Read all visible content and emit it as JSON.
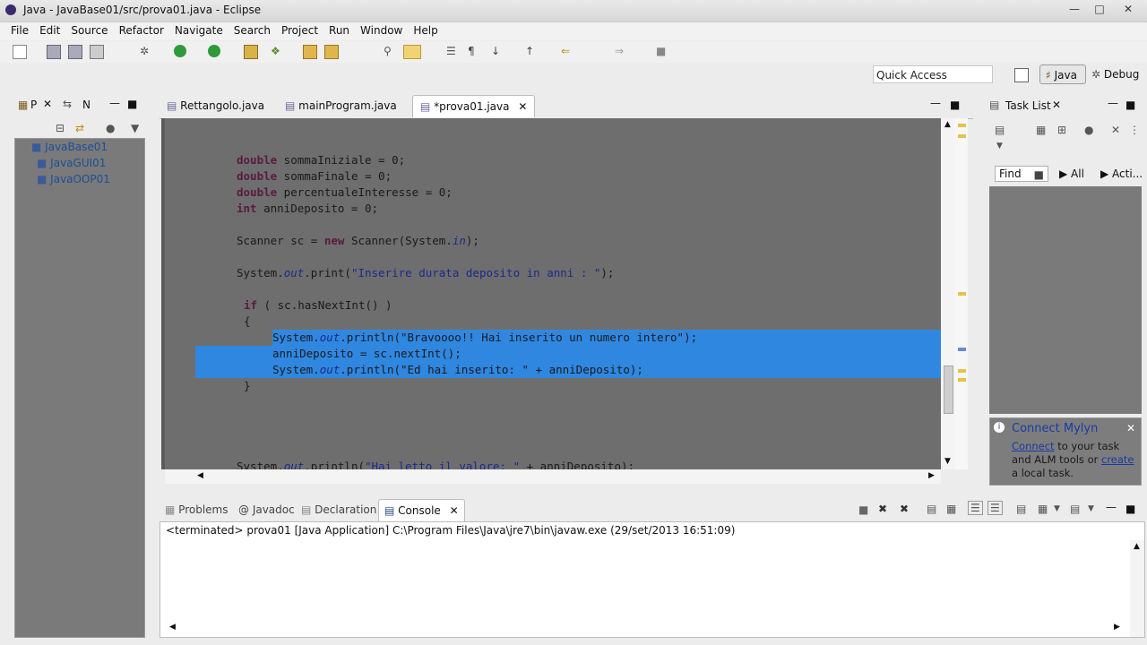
{
  "window": {
    "title": "Java - JavaBase01/src/prova01.java - Eclipse"
  },
  "menu": [
    "File",
    "Edit",
    "Source",
    "Refactor",
    "Navigate",
    "Search",
    "Project",
    "Run",
    "Window",
    "Help"
  ],
  "quick_access": {
    "placeholder": "Quick Access"
  },
  "perspectives": {
    "java": "Java",
    "debug": "Debug"
  },
  "left_panel": {
    "tab1": "P",
    "tab2": "N",
    "projects": [
      "JavaBase01",
      "JavaGUI01",
      "JavaOOP01"
    ]
  },
  "editor": {
    "tabs": [
      "Rettangolo.java",
      "mainProgram.java",
      "*prova01.java"
    ],
    "lines": [
      {
        "t": "decl",
        "kw": "double",
        "rest": " sommaIniziale = 0;"
      },
      {
        "t": "decl",
        "kw": "double",
        "rest": " sommaFinale = 0;"
      },
      {
        "t": "decl",
        "kw": "double",
        "rest": " percentualeInteresse = 0;"
      },
      {
        "t": "decl",
        "kw": "int",
        "rest": " anniDeposito = 0;"
      },
      {
        "t": "scanner",
        "a": "Scanner sc = ",
        "kw": "new",
        "b": " Scanner(System.",
        "f": "in",
        "c": ");"
      },
      {
        "t": "print",
        "a": "System.",
        "f": "out",
        "b": ".print(",
        "s": "\"Inserire durata deposito in anni : \"",
        "c": ");"
      },
      {
        "t": "if",
        "kw": "if",
        "rest": " ( sc.hasNextInt() )"
      },
      {
        "t": "plain",
        "rest": "{"
      },
      {
        "t": "println",
        "a": "System.",
        "f": "out",
        "b": ".println(",
        "s": "\"Bravoooo!! Hai inserito un numero intero\"",
        "c": ");"
      },
      {
        "t": "plain",
        "rest": "anniDeposito = sc.nextInt();"
      },
      {
        "t": "println",
        "a": "System.",
        "f": "out",
        "b": ".println(",
        "s": "\"Ed hai inserito: \"",
        "c": " + anniDeposito);"
      },
      {
        "t": "plain",
        "rest": "}"
      },
      {
        "t": "println",
        "a": "System.",
        "f": "out",
        "b": ".println(",
        "s": "\"Hai letto il valore: \"",
        "c": " + anniDeposito);"
      }
    ]
  },
  "right_panel": {
    "title": "Task List",
    "find_placeholder": "Find",
    "all_label": "All",
    "acti_label": "Acti...",
    "mylyn_title": "Connect Mylyn",
    "mylyn_text_1": "Connect",
    "mylyn_text_2": " to your task and ALM tools or ",
    "mylyn_text_3": "create",
    "mylyn_text_4": " a local task."
  },
  "bottom_panel": {
    "tabs": [
      "Problems",
      "@ Javadoc",
      "Declaration",
      "Console"
    ],
    "status": "<terminated> prova01 [Java Application] C:\\Program Files\\Java\\jre7\\bin\\javaw.exe (29/set/2013 16:51:09)"
  }
}
